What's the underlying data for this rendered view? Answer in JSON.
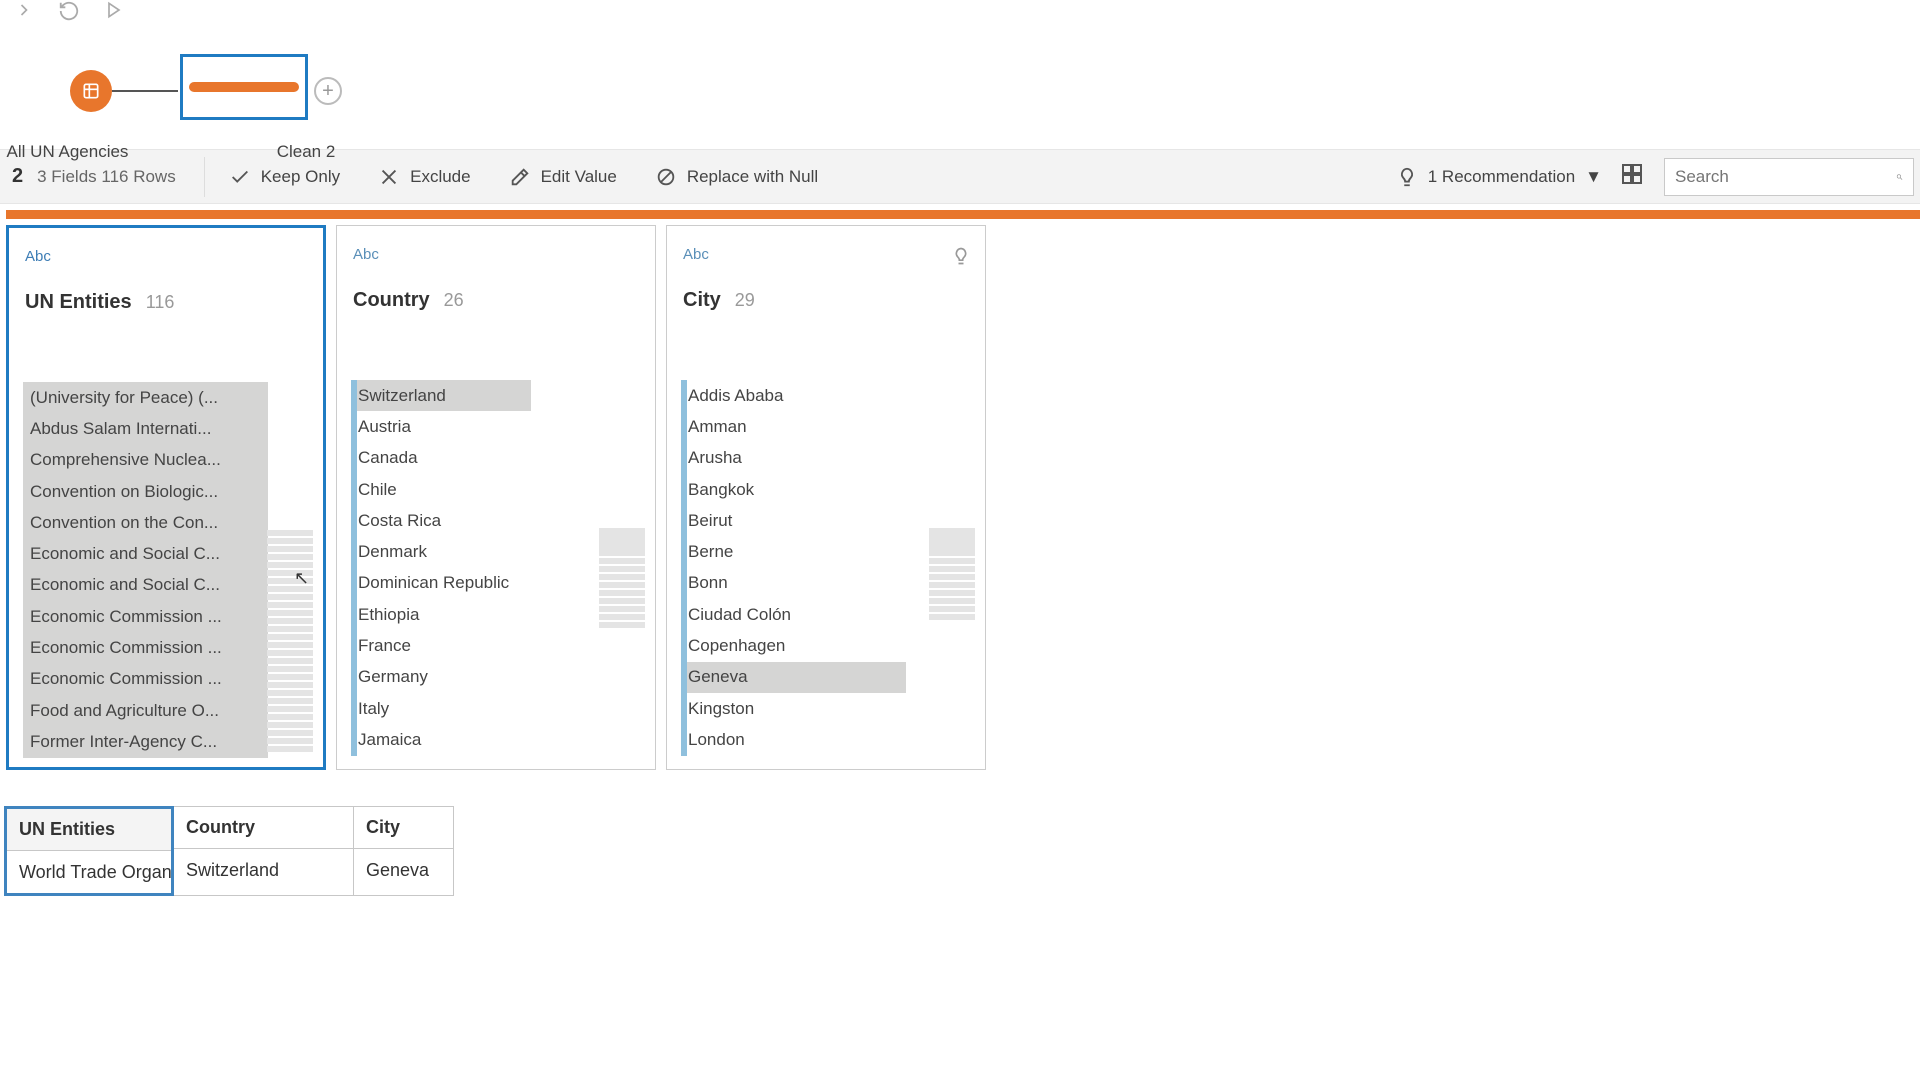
{
  "flow": {
    "source_label": "All UN Agencies",
    "step_label": "Clean 2"
  },
  "toolbar": {
    "selected_count": "2",
    "fields_rows": "3 Fields  116 Rows",
    "keep_only": "Keep Only",
    "exclude": "Exclude",
    "edit_value": "Edit Value",
    "replace_null": "Replace with Null",
    "recommendation": "1 Recommendation",
    "search_placeholder": "Search"
  },
  "cards": [
    {
      "type": "Abc",
      "name": "UN Entities",
      "count": "116",
      "values": [
        "(University for Peace) (...",
        "Abdus Salam Internati...",
        "Comprehensive Nuclea...",
        "Convention on Biologic...",
        "Convention on the Con...",
        "Economic and Social C...",
        "Economic and Social C...",
        "Economic Commission ...",
        "Economic Commission ...",
        "Economic Commission ...",
        "Food and Agriculture O...",
        "Former Inter-Agency C..."
      ]
    },
    {
      "type": "Abc",
      "name": "Country",
      "count": "26",
      "values": [
        "Switzerland",
        "Austria",
        "Canada",
        "Chile",
        "Costa Rica",
        "Denmark",
        "Dominican Republic",
        "Ethiopia",
        "France",
        "Germany",
        "Italy",
        "Jamaica"
      ]
    },
    {
      "type": "Abc",
      "name": "City",
      "count": "29",
      "values": [
        "Addis Ababa",
        "Amman",
        "Arusha",
        "Bangkok",
        "Beirut",
        "Berne",
        "Bonn",
        "Ciudad Colón",
        "Copenhagen",
        "Geneva",
        "Kingston",
        "London"
      ]
    }
  ],
  "grid": {
    "headers": [
      "UN Entities",
      "Country",
      "City"
    ],
    "row": [
      "World Trade Organ",
      "Switzerland",
      "Geneva"
    ]
  }
}
